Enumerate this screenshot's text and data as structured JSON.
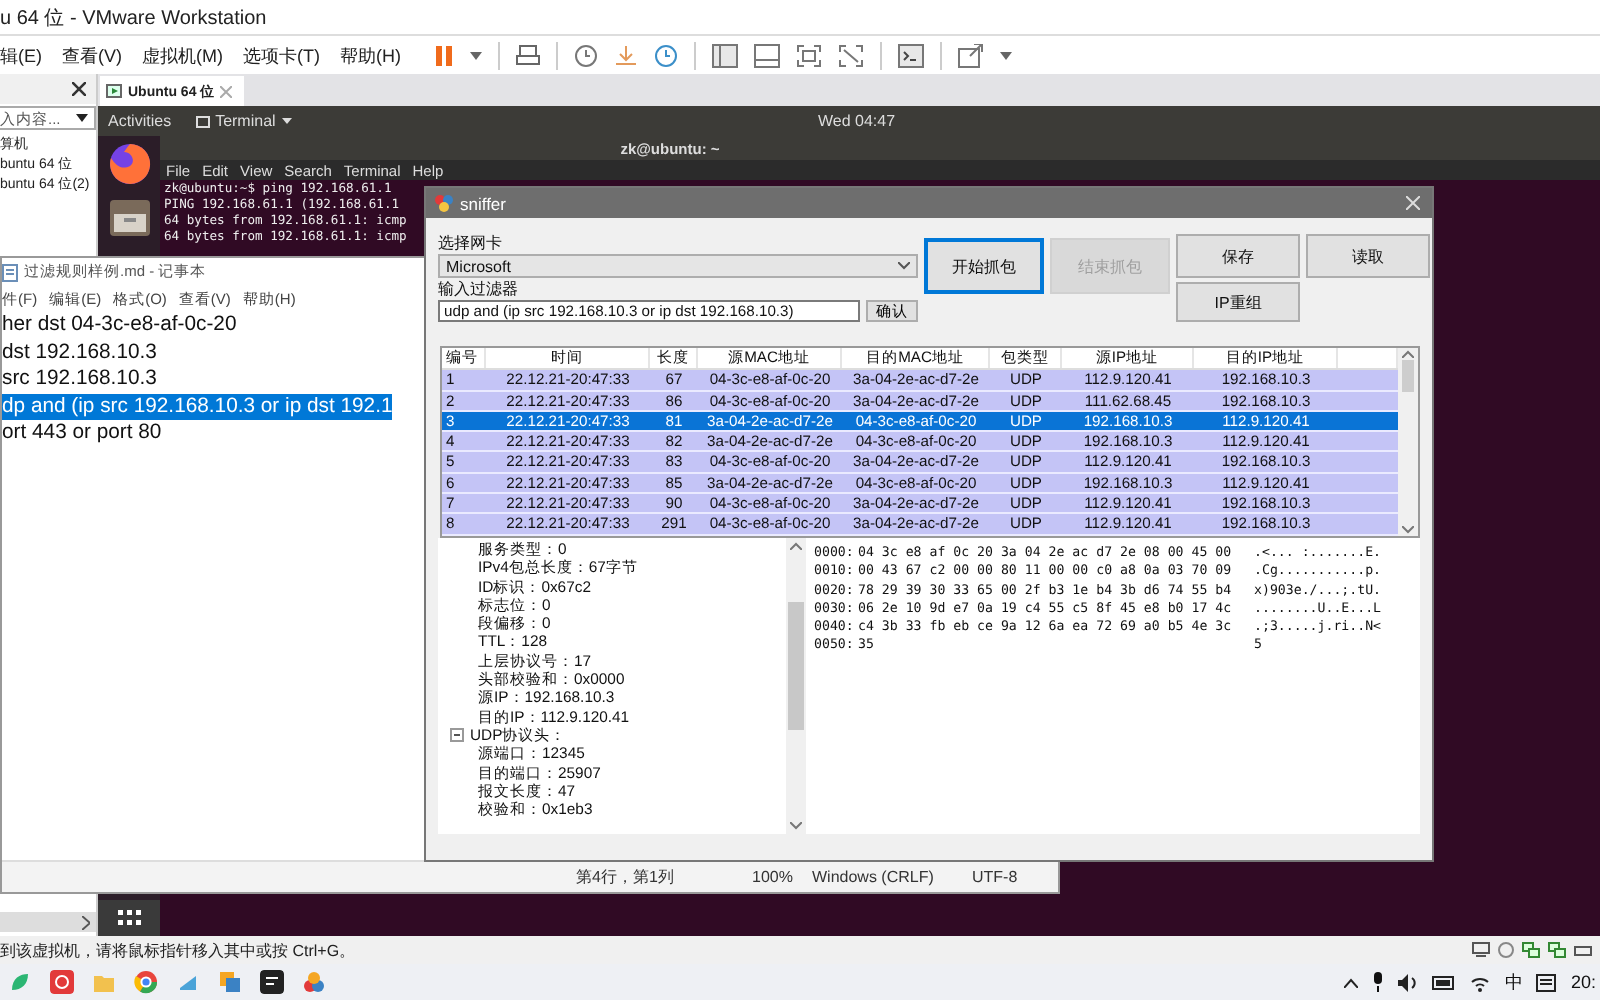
{
  "vmware": {
    "title": "u 64 位 - VMware Workstation",
    "menu": [
      "辑(E)",
      "查看(V)",
      "虚拟机(M)",
      "选项卡(T)",
      "帮助(H)"
    ],
    "library": {
      "search_placeholder": "入内容...",
      "items": [
        "算机",
        "buntu 64 位",
        "buntu 64 位(2)"
      ]
    },
    "tab": {
      "label": "Ubuntu 64 位"
    },
    "status": "到该虚拟机，请将鼠标指针移入其中或按 Ctrl+G。"
  },
  "ubuntu": {
    "activities": "Activities",
    "app_menu": "Terminal",
    "clock": "Wed 04:47"
  },
  "terminal": {
    "title": "zk@ubuntu: ~",
    "menu": [
      "File",
      "Edit",
      "View",
      "Search",
      "Terminal",
      "Help"
    ],
    "lines": [
      "zk@ubuntu:~$ ping 192.168.61.1",
      "PING 192.168.61.1 (192.168.61.1",
      "64 bytes from 192.168.61.1: icmp",
      "64 bytes from 192.168.61.1: icmp"
    ]
  },
  "notepad": {
    "title": "过滤规则样例.md - 记事本",
    "menu": [
      "件(F)",
      "编辑(E)",
      "格式(O)",
      "查看(V)",
      "帮助(H)"
    ],
    "lines": [
      {
        "text": "her dst 04-3c-e8-af-0c-20",
        "selected": false
      },
      {
        "text": "dst 192.168.10.3",
        "selected": false
      },
      {
        "text": "src 192.168.10.3",
        "selected": false
      },
      {
        "text": "dp and (ip src 192.168.10.3 or ip dst 192.1",
        "selected": true
      },
      {
        "text": "ort 443 or port 80",
        "selected": false
      }
    ],
    "status": [
      "第4行，第1列",
      "100%",
      "Windows (CRLF)",
      "UTF-8"
    ]
  },
  "sniffer": {
    "title": "sniffer",
    "nic_label": "选择网卡",
    "nic": "Microsoft",
    "filter_label": "输入过滤器",
    "filter": "udp and (ip src 192.168.10.3 or ip dst 192.168.10.3)",
    "confirm": "确认",
    "buttons": [
      {
        "label": "开始抓包",
        "disabled": false,
        "focused": true
      },
      {
        "label": "结束抓包",
        "disabled": true,
        "focused": false
      },
      {
        "label": "保存",
        "disabled": false,
        "focused": false
      },
      {
        "label": "读取",
        "disabled": false,
        "focused": false
      },
      {
        "label": "IP重组",
        "disabled": false,
        "focused": false
      }
    ],
    "table": {
      "columns": [
        "编号",
        "时间",
        "长度",
        "源MAC地址",
        "目的MAC地址",
        "包类型",
        "源IP地址",
        "目的IP地址"
      ],
      "rows": [
        {
          "cells": [
            "1",
            "22.12.21-20:47:33",
            "67",
            "04-3c-e8-af-0c-20",
            "3a-04-2e-ac-d7-2e",
            "UDP",
            "112.9.120.41",
            "192.168.10.3"
          ],
          "selected": false
        },
        {
          "cells": [
            "2",
            "22.12.21-20:47:33",
            "86",
            "04-3c-e8-af-0c-20",
            "3a-04-2e-ac-d7-2e",
            "UDP",
            "111.62.68.45",
            "192.168.10.3"
          ],
          "selected": false
        },
        {
          "cells": [
            "3",
            "22.12.21-20:47:33",
            "81",
            "3a-04-2e-ac-d7-2e",
            "04-3c-e8-af-0c-20",
            "UDP",
            "192.168.10.3",
            "112.9.120.41"
          ],
          "selected": true
        },
        {
          "cells": [
            "4",
            "22.12.21-20:47:33",
            "82",
            "3a-04-2e-ac-d7-2e",
            "04-3c-e8-af-0c-20",
            "UDP",
            "192.168.10.3",
            "112.9.120.41"
          ],
          "selected": false
        },
        {
          "cells": [
            "5",
            "22.12.21-20:47:33",
            "83",
            "04-3c-e8-af-0c-20",
            "3a-04-2e-ac-d7-2e",
            "UDP",
            "112.9.120.41",
            "192.168.10.3"
          ],
          "selected": false
        },
        {
          "cells": [
            "6",
            "22.12.21-20:47:33",
            "85",
            "3a-04-2e-ac-d7-2e",
            "04-3c-e8-af-0c-20",
            "UDP",
            "192.168.10.3",
            "112.9.120.41"
          ],
          "selected": false
        },
        {
          "cells": [
            "7",
            "22.12.21-20:47:33",
            "90",
            "04-3c-e8-af-0c-20",
            "3a-04-2e-ac-d7-2e",
            "UDP",
            "112.9.120.41",
            "192.168.10.3"
          ],
          "selected": false
        },
        {
          "cells": [
            "8",
            "22.12.21-20:47:33",
            "291",
            "04-3c-e8-af-0c-20",
            "3a-04-2e-ac-d7-2e",
            "UDP",
            "112.9.120.41",
            "192.168.10.3"
          ],
          "selected": false
        }
      ]
    },
    "details": [
      {
        "children": [
          "服务类型：0",
          "IPv4包总长度：67字节",
          "ID标识：0x67c2",
          "标志位：0",
          "段偏移：0",
          "TTL：128",
          "上层协议号：17",
          "头部校验和：0x0000",
          "源IP：192.168.10.3",
          "目的IP：112.9.120.41"
        ]
      },
      {
        "label": "UDP协议头：",
        "expanded": true,
        "children": [
          "源端口：12345",
          "目的端口：25907",
          "报文长度：47",
          "校验和：0x1eb3"
        ]
      }
    ],
    "hex": [
      {
        "offset": "0000:",
        "bytes": "04 3c e8 af 0c 20 3a 04 2e ac d7 2e 08 00 45 00",
        "ascii": ".<... :.......E."
      },
      {
        "offset": "0010:",
        "bytes": "00 43 67 c2 00 00 80 11 00 00 c0 a8 0a 03 70 09",
        "ascii": ".Cg...........p."
      },
      {
        "offset": "0020:",
        "bytes": "78 29 39 30 33 65 00 2f b3 1e b4 3b d6 74 55 b4",
        "ascii": "x)903e./...;.tU."
      },
      {
        "offset": "0030:",
        "bytes": "06 2e 10 9d e7 0a 19 c4 55 c5 8f 45 e8 b0 17 4c",
        "ascii": "........U..E...L"
      },
      {
        "offset": "0040:",
        "bytes": "c4 3b 33 fb eb ce 9a 12 6a ea 72 69 a0 b5 4e 3c",
        "ascii": ".;3.....j.ri..N<"
      },
      {
        "offset": "0050:",
        "bytes": "35",
        "ascii": "5"
      }
    ]
  },
  "taskbar": {
    "ime": "中",
    "clock": "20:"
  }
}
